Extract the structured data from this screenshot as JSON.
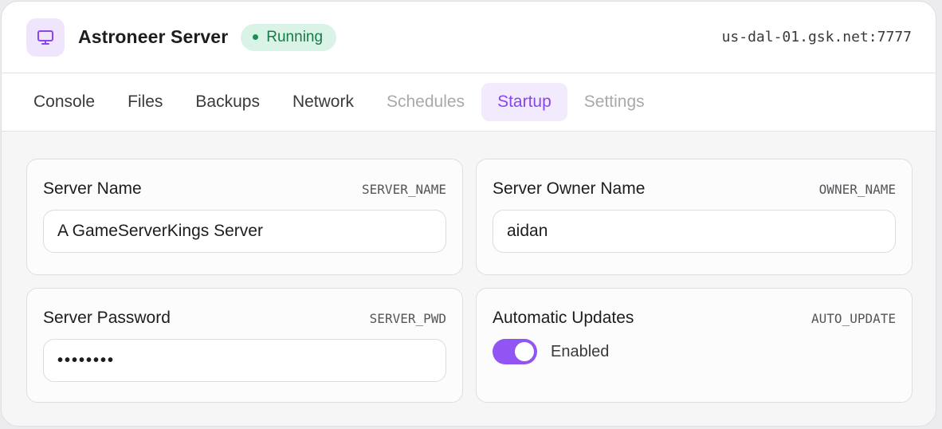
{
  "header": {
    "icon": "monitor-icon",
    "title": "Astroneer Server",
    "status": "Running",
    "status_color": "#1a8f52",
    "address": "us-dal-01.gsk.net:7777"
  },
  "tabs": [
    {
      "label": "Console",
      "state": "normal"
    },
    {
      "label": "Files",
      "state": "normal"
    },
    {
      "label": "Backups",
      "state": "normal"
    },
    {
      "label": "Network",
      "state": "normal"
    },
    {
      "label": "Schedules",
      "state": "disabled"
    },
    {
      "label": "Startup",
      "state": "active"
    },
    {
      "label": "Settings",
      "state": "disabled"
    }
  ],
  "variables": {
    "server_name": {
      "label": "Server Name",
      "env": "SERVER_NAME",
      "value": "A GameServerKings Server"
    },
    "owner_name": {
      "label": "Server Owner Name",
      "env": "OWNER_NAME",
      "value": "aidan"
    },
    "server_password": {
      "label": "Server Password",
      "env": "SERVER_PWD",
      "value": "••••••••"
    },
    "auto_update": {
      "label": "Automatic Updates",
      "env": "AUTO_UPDATE",
      "enabled": true,
      "status": "Enabled"
    }
  },
  "colors": {
    "accent": "#9155f4",
    "active_tab_text": "#8a45ee",
    "running_badge_bg": "#d9f4e6"
  }
}
